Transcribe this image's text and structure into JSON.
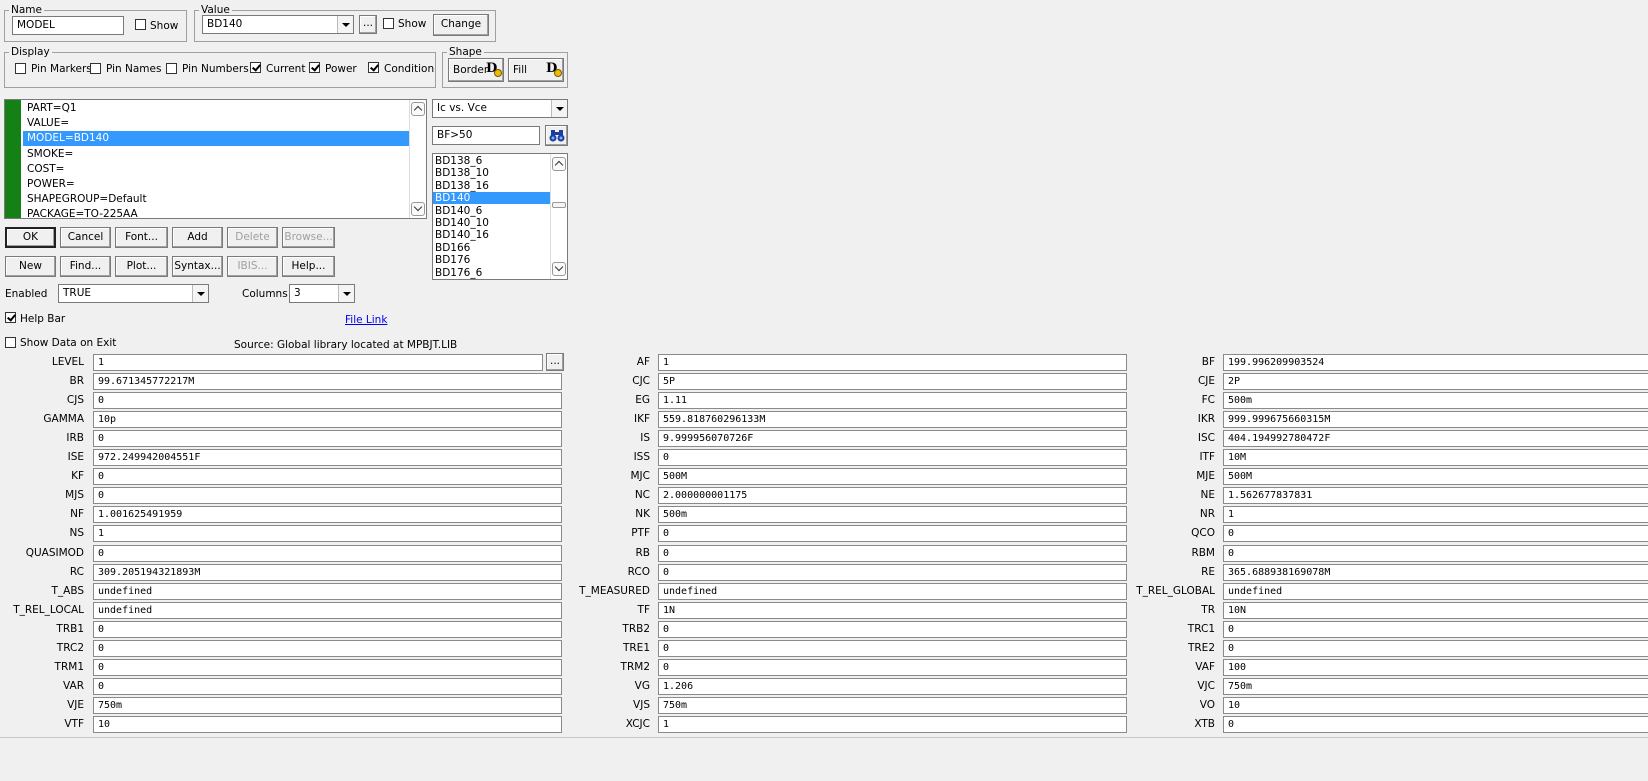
{
  "name_group": {
    "legend": "Name",
    "value": "MODEL",
    "show_label": "Show",
    "show_checked": false
  },
  "value_group": {
    "legend": "Value",
    "value": "BD140",
    "ellipsis": "...",
    "show_label": "Show",
    "show_checked": false,
    "change_label": "Change"
  },
  "display_group": {
    "legend": "Display",
    "items": [
      {
        "label": "Pin Markers",
        "checked": false
      },
      {
        "label": "Pin Names",
        "checked": false
      },
      {
        "label": "Pin Numbers",
        "checked": false
      },
      {
        "label": "Current",
        "checked": true
      },
      {
        "label": "Power",
        "checked": true
      },
      {
        "label": "Condition",
        "checked": true
      }
    ]
  },
  "shape_group": {
    "legend": "Shape",
    "border_label": "Border",
    "fill_label": "Fill"
  },
  "attributes": {
    "items": [
      "PART=Q1",
      "VALUE=",
      "MODEL=BD140",
      "SMOKE=",
      "COST=",
      "POWER=",
      "SHAPEGROUP=Default",
      "PACKAGE=TO-225AA"
    ],
    "selected_index": 2
  },
  "plot_combo": {
    "value": "Ic vs. Vce"
  },
  "filter": {
    "value": "BF>50"
  },
  "models": {
    "items": [
      "BD138_6",
      "BD138_10",
      "BD138_16",
      "BD140",
      "BD140_6",
      "BD140_10",
      "BD140_16",
      "BD166",
      "BD176",
      "BD176_6"
    ],
    "selected_index": 3
  },
  "buttons_row1": {
    "ok": "OK",
    "cancel": "Cancel",
    "font": "Font...",
    "add": "Add",
    "delete": "Delete",
    "browse": "Browse..."
  },
  "buttons_row2": {
    "new": "New",
    "find": "Find...",
    "plot": "Plot...",
    "syntax": "Syntax...",
    "ibis": "IBIS...",
    "help": "Help..."
  },
  "enabled": {
    "label": "Enabled",
    "value": "TRUE"
  },
  "columns": {
    "label": "Columns",
    "value": "3"
  },
  "help_bar": {
    "label": "Help Bar",
    "checked": true
  },
  "file_link": "File Link",
  "show_data": {
    "label": "Show Data on Exit",
    "checked": false
  },
  "source": "Source: Global library located at MPBJT.LIB",
  "level_ellipsis": "...",
  "params": [
    {
      "name": "LEVEL",
      "value": "1"
    },
    {
      "name": "AF",
      "value": "1"
    },
    {
      "name": "BF",
      "value": "199.996209903524"
    },
    {
      "name": "BR",
      "value": "99.671345772217M"
    },
    {
      "name": "CJC",
      "value": "5P"
    },
    {
      "name": "CJE",
      "value": "2P"
    },
    {
      "name": "CJS",
      "value": "0"
    },
    {
      "name": "EG",
      "value": "1.11"
    },
    {
      "name": "FC",
      "value": "500m"
    },
    {
      "name": "GAMMA",
      "value": "10p"
    },
    {
      "name": "IKF",
      "value": "559.818760296133M"
    },
    {
      "name": "IKR",
      "value": "999.999675660315M"
    },
    {
      "name": "IRB",
      "value": "0"
    },
    {
      "name": "IS",
      "value": "9.999956070726F"
    },
    {
      "name": "ISC",
      "value": "404.194992780472F"
    },
    {
      "name": "ISE",
      "value": "972.249942004551F"
    },
    {
      "name": "ISS",
      "value": "0"
    },
    {
      "name": "ITF",
      "value": "10M"
    },
    {
      "name": "KF",
      "value": "0"
    },
    {
      "name": "MJC",
      "value": "500M"
    },
    {
      "name": "MJE",
      "value": "500M"
    },
    {
      "name": "MJS",
      "value": "0"
    },
    {
      "name": "NC",
      "value": "2.000000001175"
    },
    {
      "name": "NE",
      "value": "1.562677837831"
    },
    {
      "name": "NF",
      "value": "1.001625491959"
    },
    {
      "name": "NK",
      "value": "500m"
    },
    {
      "name": "NR",
      "value": "1"
    },
    {
      "name": "NS",
      "value": "1"
    },
    {
      "name": "PTF",
      "value": "0"
    },
    {
      "name": "QCO",
      "value": "0"
    },
    {
      "name": "QUASIMOD",
      "value": "0"
    },
    {
      "name": "RB",
      "value": "0"
    },
    {
      "name": "RBM",
      "value": "0"
    },
    {
      "name": "RC",
      "value": "309.205194321893M"
    },
    {
      "name": "RCO",
      "value": "0"
    },
    {
      "name": "RE",
      "value": "365.688938169078M"
    },
    {
      "name": "T_ABS",
      "value": "undefined"
    },
    {
      "name": "T_MEASURED",
      "value": "undefined"
    },
    {
      "name": "T_REL_GLOBAL",
      "value": "undefined"
    },
    {
      "name": "T_REL_LOCAL",
      "value": "undefined"
    },
    {
      "name": "TF",
      "value": "1N"
    },
    {
      "name": "TR",
      "value": "10N"
    },
    {
      "name": "TRB1",
      "value": "0"
    },
    {
      "name": "TRB2",
      "value": "0"
    },
    {
      "name": "TRC1",
      "value": "0"
    },
    {
      "name": "TRC2",
      "value": "0"
    },
    {
      "name": "TRE1",
      "value": "0"
    },
    {
      "name": "TRE2",
      "value": "0"
    },
    {
      "name": "TRM1",
      "value": "0"
    },
    {
      "name": "TRM2",
      "value": "0"
    },
    {
      "name": "VAF",
      "value": "100"
    },
    {
      "name": "VAR",
      "value": "0"
    },
    {
      "name": "VG",
      "value": "1.206"
    },
    {
      "name": "VJC",
      "value": "750m"
    },
    {
      "name": "VJE",
      "value": "750m"
    },
    {
      "name": "VJS",
      "value": "750m"
    },
    {
      "name": "VO",
      "value": "10"
    },
    {
      "name": "VTF",
      "value": "10"
    },
    {
      "name": "XCJC",
      "value": "1"
    },
    {
      "name": "XTB",
      "value": "0"
    }
  ]
}
